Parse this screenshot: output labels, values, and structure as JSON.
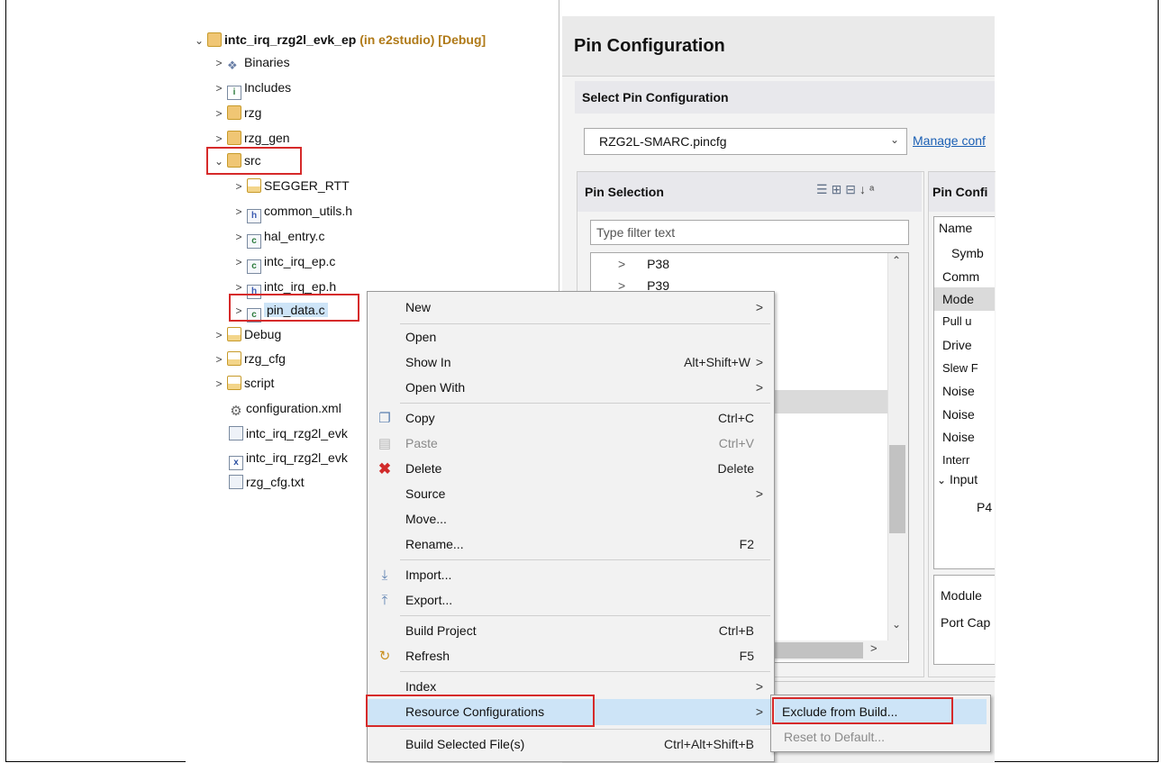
{
  "project": {
    "name": "intc_irq_rzg2l_evk_ep",
    "suffix": "(in e2studio) [Debug]",
    "items": [
      {
        "label": "Binaries",
        "chevron": ">",
        "icon": "binaries-icon"
      },
      {
        "label": "Includes",
        "chevron": ">",
        "icon": "includes-icon"
      },
      {
        "label": "rzg",
        "chevron": ">",
        "icon": "package-folder-icon"
      },
      {
        "label": "rzg_gen",
        "chevron": ">",
        "icon": "package-folder-icon"
      },
      {
        "label": "src",
        "chevron": "⌄",
        "icon": "package-folder-icon"
      },
      {
        "label": "SEGGER_RTT",
        "chevron": ">",
        "icon": "folder-icon"
      },
      {
        "label": "common_utils.h",
        "chevron": ">",
        "icon": "h-file-icon"
      },
      {
        "label": "hal_entry.c",
        "chevron": ">",
        "icon": "c-file-icon"
      },
      {
        "label": "intc_irq_ep.c",
        "chevron": ">",
        "icon": "c-file-icon"
      },
      {
        "label": "intc_irq_ep.h",
        "chevron": ">",
        "icon": "h-file-icon"
      },
      {
        "label": "pin_data.c",
        "chevron": ">",
        "icon": "c-file-icon"
      },
      {
        "label": "Debug",
        "chevron": ">",
        "icon": "folder-icon"
      },
      {
        "label": "rzg_cfg",
        "chevron": ">",
        "icon": "folder-icon"
      },
      {
        "label": "script",
        "chevron": ">",
        "icon": "folder-icon"
      },
      {
        "label": "configuration.xml",
        "chevron": "",
        "icon": "gear-icon"
      },
      {
        "label": "intc_irq_rzg2l_evk",
        "chevron": "",
        "icon": "text-file-icon"
      },
      {
        "label": "intc_irq_rzg2l_evk",
        "chevron": "",
        "icon": "xml-file-icon"
      },
      {
        "label": "rzg_cfg.txt",
        "chevron": "",
        "icon": "text-file-icon"
      }
    ]
  },
  "pin_config": {
    "title": "Pin Configuration",
    "select_header": "Select Pin Configuration",
    "selected_file": "RZG2L-SMARC.pincfg",
    "manage_link": "Manage conf",
    "pin_selection_header": "Pin Selection",
    "filter_placeholder": "Type filter text",
    "pins": [
      "P38",
      "P39"
    ],
    "pin_config_header": "Pin Confi",
    "props_name_header": "Name",
    "props": [
      "Symb",
      "Comm",
      "Mode",
      "Pull u",
      "Drive",
      "Slew F",
      "Noise",
      "Noise",
      "Noise",
      "Interr",
      "Input",
      "P4"
    ],
    "bottom_items": [
      "Module",
      "Port Cap"
    ]
  },
  "context_menu": {
    "items": [
      {
        "label": "New",
        "accel": "",
        "submenu": true,
        "icon": ""
      },
      {
        "label": "Open",
        "accel": "",
        "submenu": false,
        "icon": ""
      },
      {
        "label": "Show In",
        "accel": "Alt+Shift+W",
        "submenu": true,
        "icon": ""
      },
      {
        "label": "Open With",
        "accel": "",
        "submenu": true,
        "icon": ""
      },
      {
        "label": "Copy",
        "accel": "Ctrl+C",
        "submenu": false,
        "icon": "copy-icon"
      },
      {
        "label": "Paste",
        "accel": "Ctrl+V",
        "submenu": false,
        "icon": "paste-icon",
        "disabled": true
      },
      {
        "label": "Delete",
        "accel": "Delete",
        "submenu": false,
        "icon": "delete-icon"
      },
      {
        "label": "Source",
        "accel": "",
        "submenu": true,
        "icon": ""
      },
      {
        "label": "Move...",
        "accel": "",
        "submenu": false,
        "icon": ""
      },
      {
        "label": "Rename...",
        "accel": "F2",
        "submenu": false,
        "icon": ""
      },
      {
        "label": "Import...",
        "accel": "",
        "submenu": false,
        "icon": "import-icon"
      },
      {
        "label": "Export...",
        "accel": "",
        "submenu": false,
        "icon": "export-icon"
      },
      {
        "label": "Build Project",
        "accel": "Ctrl+B",
        "submenu": false,
        "icon": ""
      },
      {
        "label": "Refresh",
        "accel": "F5",
        "submenu": false,
        "icon": "refresh-icon"
      },
      {
        "label": "Index",
        "accel": "",
        "submenu": true,
        "icon": ""
      },
      {
        "label": "Resource Configurations",
        "accel": "",
        "submenu": true,
        "icon": ""
      },
      {
        "label": "Build Selected File(s)",
        "accel": "Ctrl+Alt+Shift+B",
        "submenu": false,
        "icon": ""
      }
    ]
  },
  "submenu": {
    "items": [
      {
        "label": "Exclude from Build...",
        "disabled": false
      },
      {
        "label": "Reset to Default...",
        "disabled": true
      }
    ]
  },
  "colors": {
    "highlight": "#cde4f7",
    "annotation_red": "#d62a2a",
    "link": "#1a5fb4"
  }
}
